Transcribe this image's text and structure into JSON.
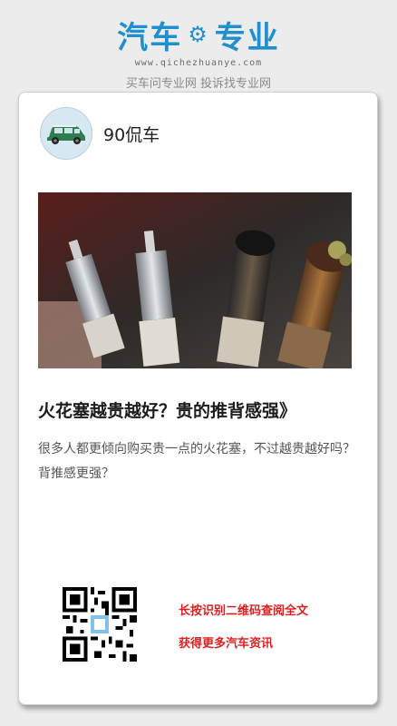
{
  "brand": {
    "name_left": "汽车",
    "name_right": "专业",
    "url": "www.qichezhuanye.com",
    "slogan": "买车问专业网 投诉找专业网",
    "color": "#1f8fcf"
  },
  "article": {
    "author": "90侃车",
    "title": "火花塞越贵越好？贵的推背感强》",
    "summary": "很多人都更倾向购买贵一点的火花塞，不过越贵越好吗？背推感更强？",
    "image_icon": "spark-plugs-photo"
  },
  "qr": {
    "line1": "长按识别二维码查阅全文",
    "line2": "获得更多汽车资讯",
    "color": "#e02020"
  }
}
